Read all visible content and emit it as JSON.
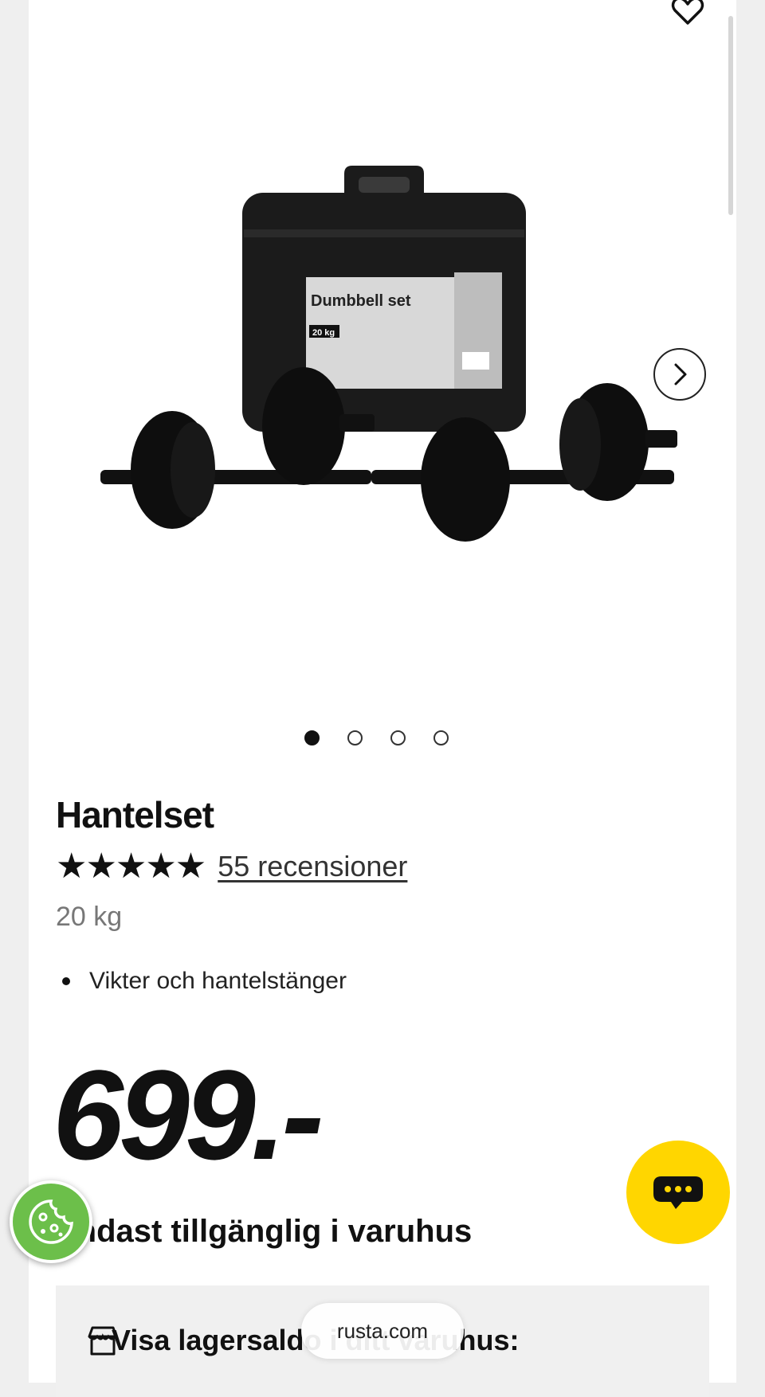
{
  "product": {
    "title": "Hantelset",
    "rating": 5,
    "rating_max": 5,
    "stars": "★★★★★",
    "reviews_label": "55 recensioner",
    "weight": "20 kg",
    "bullets": [
      "Vikter och hantelstänger"
    ],
    "price": "699.-",
    "availability": "Endast tillgänglig i varuhus"
  },
  "gallery": {
    "image_count": 4,
    "active_index": 1,
    "box_title": "Dumbbell set",
    "box_weight": "20 kg",
    "next_icon": "chevron-right-icon"
  },
  "stock": {
    "label": "Visa lagersaldo i ditt varuhus:",
    "icon": "store-icon"
  },
  "browser": {
    "url": "rusta.com"
  },
  "colors": {
    "chat_button": "#ffd600",
    "cookie_button": "#6cbf4a"
  }
}
